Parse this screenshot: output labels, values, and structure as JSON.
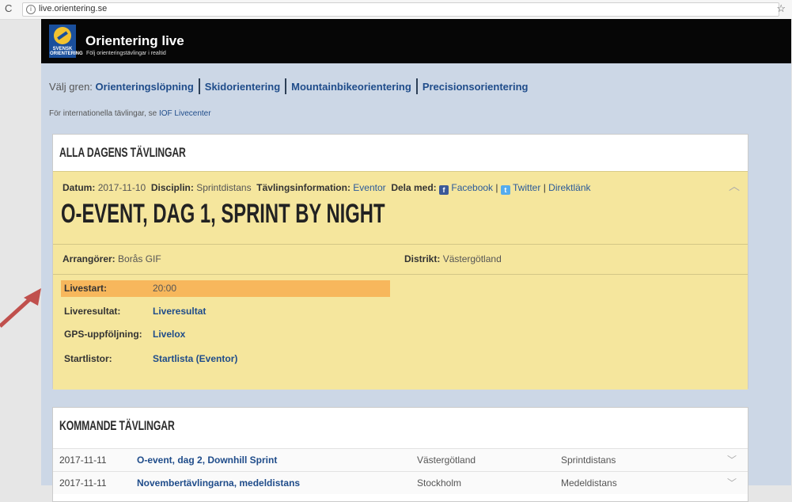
{
  "browser": {
    "url": "live.orientering.se",
    "reload_icon": "reload-icon",
    "star_icon": "star-icon"
  },
  "header": {
    "logo_text": "SVENSK ORIENTERING",
    "title": "Orientering live",
    "subtitle": "Följ orienteringstävlingar i realtid"
  },
  "nav": {
    "label": "Välj gren:",
    "items": [
      "Orienteringslöpning",
      "Skidorientering",
      "Mountainbikeorientering",
      "Precisionsorientering"
    ]
  },
  "intl": {
    "text": "För internationella tävlingar, se",
    "link": "IOF Livecenter"
  },
  "today": {
    "heading": "ALLA DAGENS TÄVLINGAR",
    "event": {
      "date_label": "Datum:",
      "date": "2017-11-10",
      "discipline_label": "Disciplin:",
      "discipline": "Sprintdistans",
      "info_label": "Tävlingsinformation:",
      "info_link": "Eventor",
      "share_label": "Dela med:",
      "facebook": "Facebook",
      "twitter": "Twitter",
      "direct": "Direktlänk",
      "sep": "|",
      "title": "O-EVENT, DAG 1, SPRINT BY NIGHT",
      "organizer_label": "Arrangörer:",
      "organizer": "Borås GIF",
      "district_label": "Distrikt:",
      "district": "Västergötland",
      "livestart_label": "Livestart:",
      "livestart": "20:00",
      "liveresult_label": "Liveresultat:",
      "liveresult": "Liveresultat",
      "gps_label": "GPS-uppföljning:",
      "gps": "Livelox",
      "startlist_label": "Startlistor:",
      "startlist": "Startlista (Eventor)"
    }
  },
  "upcoming": {
    "heading": "KOMMANDE TÄVLINGAR",
    "rows": [
      {
        "date": "2017-11-11",
        "name": "O-event, dag 2, Downhill Sprint",
        "district": "Västergötland",
        "discipline": "Sprintdistans"
      },
      {
        "date": "2017-11-11",
        "name": "Novembertävlingarna, medeldistans",
        "district": "Stockholm",
        "discipline": "Medeldistans"
      }
    ]
  }
}
